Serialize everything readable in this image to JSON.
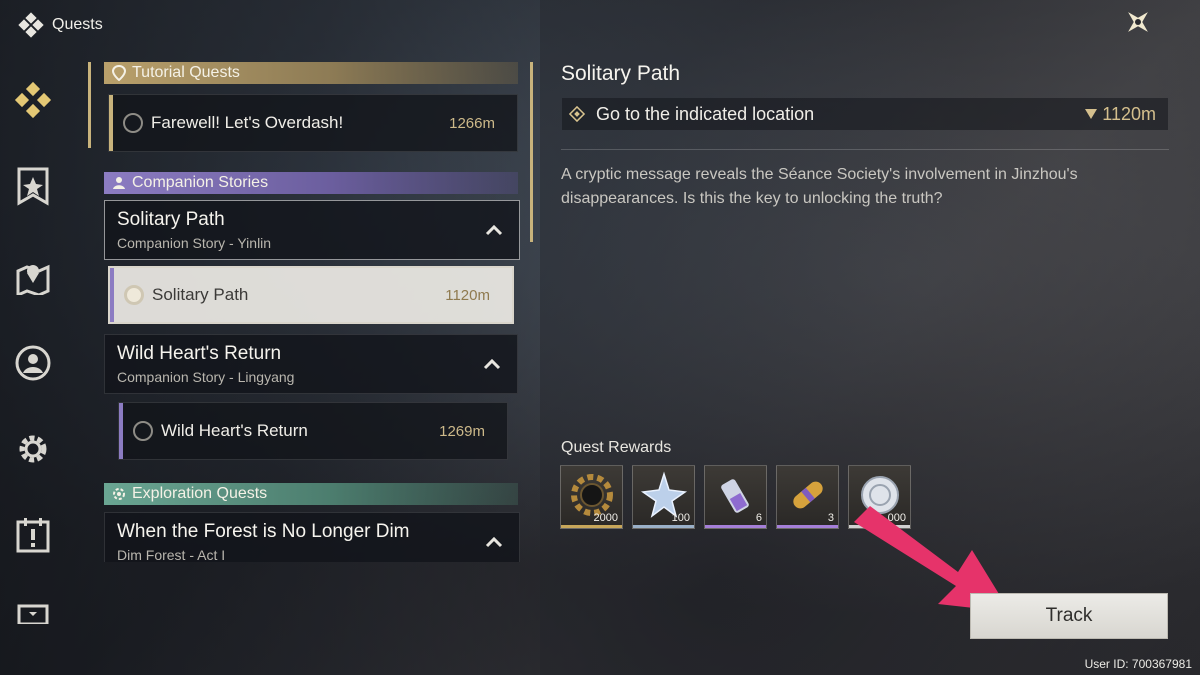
{
  "header": {
    "title": "Quests",
    "close_icon": "close-x-icon"
  },
  "nav": {
    "items": [
      {
        "name": "quests",
        "icon": "quests-diamond-icon",
        "active": true
      },
      {
        "name": "banner",
        "icon": "banner-shield-icon"
      },
      {
        "name": "map",
        "icon": "map-pin-icon"
      },
      {
        "name": "profile",
        "icon": "character-icon"
      },
      {
        "name": "settings",
        "icon": "gear-icon"
      },
      {
        "name": "events",
        "icon": "calendar-alert-icon"
      },
      {
        "name": "more",
        "icon": "monitor-icon"
      }
    ]
  },
  "quest_list": {
    "categories": {
      "tutorial": "Tutorial Quests",
      "companion": "Companion Stories",
      "exploration": "Exploration Quests"
    },
    "tutorial_quest": {
      "name": "Farewell! Let's Overdash!",
      "distance": "1266m"
    },
    "story1": {
      "title": "Solitary Path",
      "subtitle": "Companion Story - Yinlin",
      "quest": {
        "name": "Solitary Path",
        "distance": "1120m",
        "selected": true
      }
    },
    "story2": {
      "title": "Wild Heart's Return",
      "subtitle": "Companion Story - Lingyang",
      "quest": {
        "name": "Wild Heart's Return",
        "distance": "1269m"
      }
    },
    "story3": {
      "title": "When the Forest is No Longer Dim",
      "subtitle": "Dim Forest - Act I"
    }
  },
  "detail": {
    "title": "Solitary Path",
    "objective": "Go to the indicated location",
    "objective_distance": "1120m",
    "description": "A cryptic message reveals the Séance Society's involvement in Jinzhou's disappearances. Is this the key to unlocking the truth?",
    "rewards_label": "Quest Rewards",
    "rewards": [
      {
        "icon": "gear-coin-icon",
        "qty": "2000",
        "rarity_color": "#c8a75a"
      },
      {
        "icon": "star-crystal-icon",
        "qty": "100",
        "rarity_color": "#9ab0c8"
      },
      {
        "icon": "potion-vial-icon",
        "qty": "6",
        "rarity_color": "#a57fd8"
      },
      {
        "icon": "capsule-icon",
        "qty": "3",
        "rarity_color": "#a57fd8"
      },
      {
        "icon": "coin-disc-icon",
        "qty": "000",
        "rarity_color": "#d0d0d0"
      }
    ],
    "track_label": "Track"
  },
  "footer": {
    "user_id": "User ID: 700367981"
  },
  "colors": {
    "accent_gold": "#c8b37c",
    "companion_purple": "#8c7cc2",
    "explore_green": "#6aa693",
    "arrow_pink": "#e6336a"
  }
}
